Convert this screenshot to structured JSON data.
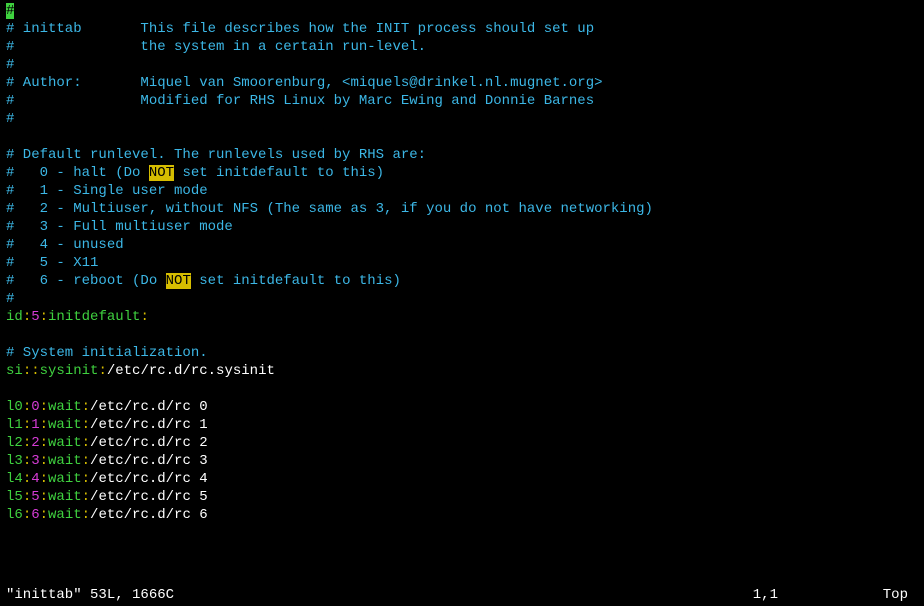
{
  "header": {
    "l1a": "# inittab       This file describes how the INIT process should set up",
    "l2a": "#               the system in a certain run-level.",
    "l3a": "# Author:       Miquel van Smoorenburg, <miquels@drinkel.nl.mugnet.org>",
    "l4a": "#               Modified for RHS Linux by Marc Ewing and Donnie Barnes"
  },
  "runlevels": {
    "intro": "# Default runlevel. The runlevels used by RHS are:",
    "r0a": "#   0 - halt (Do ",
    "r0b": "NOT",
    "r0c": " set initdefault to this)",
    "r1": "#   1 - Single user mode",
    "r2": "#   2 - Multiuser, without NFS (The same as 3, if you do not have networking)",
    "r3": "#   3 - Full multiuser mode",
    "r4": "#   4 - unused",
    "r5": "#   5 - X11",
    "r6a": "#   6 - reboot (Do ",
    "r6b": "NOT",
    "r6c": " set initdefault to this)"
  },
  "entries": {
    "id_a": "id",
    "id_b": ":",
    "id_c": "5",
    "id_d": ":",
    "id_e": "initdefault",
    "id_f": ":",
    "sysinit_comment": "# System initialization.",
    "si_a": "si",
    "si_b": "::",
    "si_c": "sysinit",
    "si_d": ":",
    "si_e": "/etc/rc.d/rc.sysinit",
    "l0_a": "l0",
    "l0_b": ":",
    "l0_c": "0",
    "l0_d": ":",
    "l0_e": "wait",
    "l0_f": ":",
    "l0_g": "/etc/rc.d/rc 0",
    "l1_a": "l1",
    "l1_b": ":",
    "l1_c": "1",
    "l1_d": ":",
    "l1_e": "wait",
    "l1_f": ":",
    "l1_g": "/etc/rc.d/rc 1",
    "l2_a": "l2",
    "l2_b": ":",
    "l2_c": "2",
    "l2_d": ":",
    "l2_e": "wait",
    "l2_f": ":",
    "l2_g": "/etc/rc.d/rc 2",
    "l3_a": "l3",
    "l3_b": ":",
    "l3_c": "3",
    "l3_d": ":",
    "l3_e": "wait",
    "l3_f": ":",
    "l3_g": "/etc/rc.d/rc 3",
    "l4_a": "l4",
    "l4_b": ":",
    "l4_c": "4",
    "l4_d": ":",
    "l4_e": "wait",
    "l4_f": ":",
    "l4_g": "/etc/rc.d/rc 4",
    "l5_a": "l5",
    "l5_b": ":",
    "l5_c": "5",
    "l5_d": ":",
    "l5_e": "wait",
    "l5_f": ":",
    "l5_g": "/etc/rc.d/rc 5",
    "l6_a": "l6",
    "l6_b": ":",
    "l6_c": "6",
    "l6_d": ":",
    "l6_e": "wait",
    "l6_f": ":",
    "l6_g": "/etc/rc.d/rc 6"
  },
  "hash": "#",
  "hash_cursor": "#",
  "status": {
    "file": "\"inittab\" 53L, 1666C",
    "pos": "1,1",
    "pct": "Top"
  }
}
